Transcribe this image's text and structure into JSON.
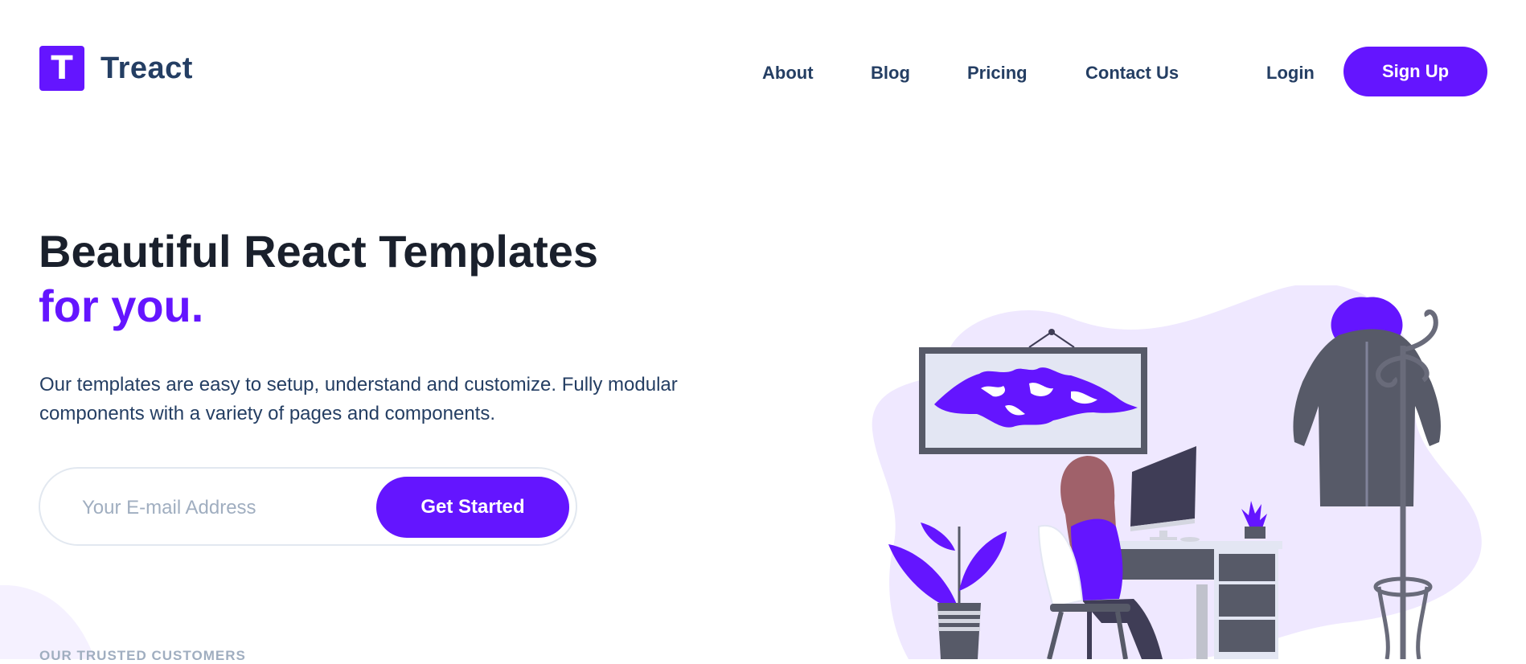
{
  "brand": {
    "logo_letter": "T",
    "name": "Treact"
  },
  "nav": {
    "links": [
      "About",
      "Blog",
      "Pricing",
      "Contact Us"
    ],
    "login": "Login",
    "signup": "Sign Up"
  },
  "hero": {
    "heading_line1": "Beautiful React Templates",
    "heading_line2": "for you.",
    "description": "Our templates are easy to setup, understand and customize. Fully modular components with a variety of pages and components.",
    "email_placeholder": "Your E-mail Address",
    "email_value": "",
    "cta": "Get Started"
  },
  "trusted": {
    "label": "OUR TRUSTED CUSTOMERS"
  },
  "colors": {
    "primary": "#6415ff",
    "heading": "#1a202c",
    "nav_text": "#243e63",
    "muted": "#a0aec0",
    "blob": "#efe8ff"
  },
  "icons": [
    "logo-mark"
  ]
}
